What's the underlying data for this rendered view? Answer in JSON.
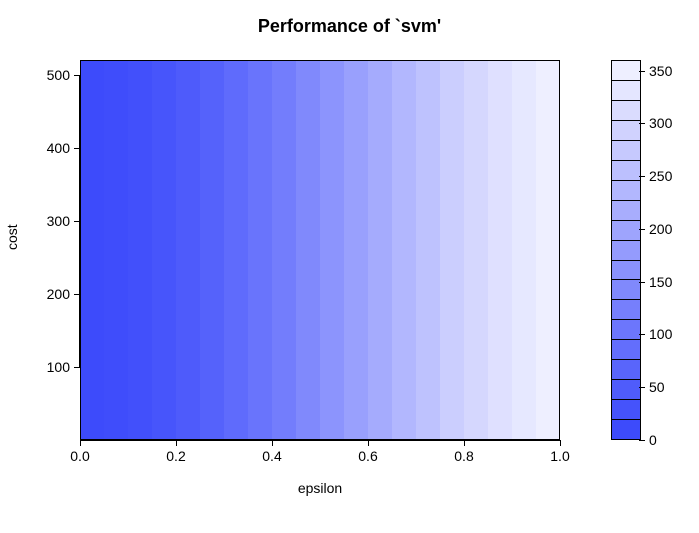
{
  "chart_data": {
    "type": "heatmap",
    "title": "Performance of `svm'",
    "xlabel": "epsilon",
    "ylabel": "cost",
    "x_ticks": [
      0.0,
      0.2,
      0.4,
      0.6,
      0.8,
      1.0
    ],
    "y_ticks": [
      100,
      200,
      300,
      400,
      500
    ],
    "xlim": [
      0.0,
      1.0
    ],
    "ylim": [
      0,
      520
    ],
    "legend_ticks": [
      0,
      50,
      100,
      150,
      200,
      250,
      300,
      350
    ],
    "legend_range": [
      0,
      360
    ],
    "note": "z-value (performance metric) varies essentially with epsilon only; approximately constant across cost.",
    "bands": [
      {
        "epsilon_mid": 0.025,
        "value": 0,
        "color": "#3D4BFB"
      },
      {
        "epsilon_mid": 0.075,
        "value": 7,
        "color": "#3F4DFB"
      },
      {
        "epsilon_mid": 0.125,
        "value": 15,
        "color": "#4250FB"
      },
      {
        "epsilon_mid": 0.175,
        "value": 25,
        "color": "#4755FB"
      },
      {
        "epsilon_mid": 0.225,
        "value": 40,
        "color": "#4E5BFB"
      },
      {
        "epsilon_mid": 0.275,
        "value": 55,
        "color": "#5562FB"
      },
      {
        "epsilon_mid": 0.325,
        "value": 75,
        "color": "#5F6BFC"
      },
      {
        "epsilon_mid": 0.375,
        "value": 95,
        "color": "#6974FC"
      },
      {
        "epsilon_mid": 0.425,
        "value": 115,
        "color": "#737DFC"
      },
      {
        "epsilon_mid": 0.475,
        "value": 140,
        "color": "#8089FC"
      },
      {
        "epsilon_mid": 0.525,
        "value": 165,
        "color": "#8C94FD"
      },
      {
        "epsilon_mid": 0.575,
        "value": 190,
        "color": "#99A0FD"
      },
      {
        "epsilon_mid": 0.625,
        "value": 215,
        "color": "#A5ABFD"
      },
      {
        "epsilon_mid": 0.675,
        "value": 240,
        "color": "#B2B7FE"
      },
      {
        "epsilon_mid": 0.725,
        "value": 265,
        "color": "#BEC2FE"
      },
      {
        "epsilon_mid": 0.775,
        "value": 290,
        "color": "#CBCEFE"
      },
      {
        "epsilon_mid": 0.825,
        "value": 310,
        "color": "#D5D7FE"
      },
      {
        "epsilon_mid": 0.875,
        "value": 330,
        "color": "#DFE0FF"
      },
      {
        "epsilon_mid": 0.925,
        "value": 345,
        "color": "#E6E8FF"
      },
      {
        "epsilon_mid": 0.975,
        "value": 360,
        "color": "#EEEFFF"
      }
    ],
    "legend_cells": [
      {
        "color": "#EEEFFF"
      },
      {
        "color": "#E4E6FF"
      },
      {
        "color": "#DADCFE"
      },
      {
        "color": "#D0D2FE"
      },
      {
        "color": "#C6C9FE"
      },
      {
        "color": "#BCC0FE"
      },
      {
        "color": "#B2B7FE"
      },
      {
        "color": "#A8ADFD"
      },
      {
        "color": "#9EA4FD"
      },
      {
        "color": "#949BFD"
      },
      {
        "color": "#8A92FC"
      },
      {
        "color": "#8089FC"
      },
      {
        "color": "#767FFC"
      },
      {
        "color": "#6C76FC"
      },
      {
        "color": "#636EFC"
      },
      {
        "color": "#5965FB"
      },
      {
        "color": "#4F5CFB"
      },
      {
        "color": "#4553FB"
      },
      {
        "color": "#3D4BFB"
      }
    ]
  }
}
